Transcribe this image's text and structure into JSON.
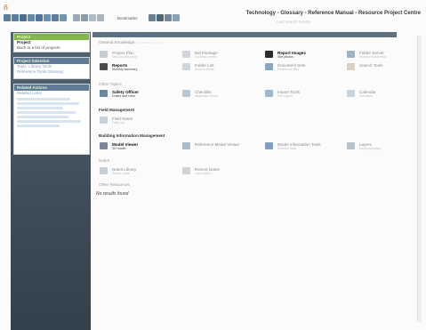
{
  "colors": {
    "accent_green": "#82b84a",
    "sidebar_bg": "#465764",
    "tab_bar": "#5d7282"
  },
  "app": {
    "logo_glyph": "ñ",
    "window_title": "Technology - Glossary - Reference Manual - Resource Project Centre",
    "subtitle": "Last search results",
    "toolbar_label": "Bookmarks",
    "toolbar_icons": [
      "back-arrow-icon",
      "forward-arrow-icon",
      "books-icon",
      "book-icon",
      "library-icon",
      "refresh-icon",
      "home-icon",
      "panel-icon",
      "bookmark-icon",
      "print-icon",
      "search-icon",
      "notes-icon",
      "tools-icon",
      "settings-icon",
      "help-icon",
      "info-icon"
    ]
  },
  "sidebar": {
    "panel1": {
      "header": "Project",
      "title": "Project",
      "line": "Back to a list of projects"
    },
    "panel2": {
      "header": "Project Selection",
      "lines": [
        "Topic: Library Tools",
        "Reference Tools Glossary"
      ]
    },
    "panel3": {
      "header": "Related Actions",
      "line": "Related Links"
    }
  },
  "main": {
    "tab_strip": "Related Topics   Articles   Bookmarks   Glossary",
    "cat_general": "General Knowledge",
    "cat_other": "Other Topics",
    "cat_field": "Field Management",
    "cat_building": "Building Information Management",
    "cat_notes": "Notes",
    "cat_footer": "Other Resources",
    "no_results": "No results found",
    "items": [
      {
        "id": "a1",
        "title": "Project Plan",
        "sub": "Step-by-step plan",
        "icon": "plan-icon",
        "strong": false
      },
      {
        "id": "a2",
        "title": "Bid Package",
        "sub": "Contract review",
        "icon": "package-icon",
        "strong": false
      },
      {
        "id": "a3",
        "title": "Report Images",
        "sub": "Site photos",
        "icon": "camera-icon",
        "strong": true
      },
      {
        "id": "a4",
        "title": "Folder Server",
        "sub": "Shared documents",
        "icon": "server-icon",
        "strong": false
      },
      {
        "id": "b1",
        "title": "Reports",
        "sub": "Monthly summary",
        "icon": "report-icon",
        "strong": true
      },
      {
        "id": "b2",
        "title": "Folder List",
        "sub": "Archive items",
        "icon": "folder-icon",
        "strong": false
      },
      {
        "id": "b3",
        "title": "Document Sets",
        "sub": "Reference files",
        "icon": "documents-icon",
        "strong": false
      },
      {
        "id": "b4",
        "title": "Search Tools",
        "sub": "",
        "icon": "search-tool-icon",
        "strong": false
      },
      {
        "id": "c1",
        "title": "Safety Officer",
        "sub": "Duties and roles",
        "icon": "safety-icon",
        "strong": true
      },
      {
        "id": "c2",
        "title": "Checklist",
        "sub": "Inspection items",
        "icon": "checklist-icon",
        "strong": false
      },
      {
        "id": "c3",
        "title": "Import Tools",
        "sub": "File import",
        "icon": "import-icon",
        "strong": false
      },
      {
        "id": "c4",
        "title": "Calendar",
        "sub": "Schedule",
        "icon": "calendar-icon",
        "strong": false
      },
      {
        "id": "d1",
        "title": "Field Notes",
        "sub": "Daily log",
        "icon": "notes-icon",
        "strong": false
      },
      {
        "id": "e1",
        "title": "Model Viewer",
        "sub": "3D model",
        "icon": "model-icon",
        "strong": true
      },
      {
        "id": "e2",
        "title": "Reference Model Viewer",
        "sub": "",
        "icon": "viewer-icon",
        "strong": false
      },
      {
        "id": "e3",
        "title": "Model Information Tools",
        "sub": "Element data",
        "icon": "info-model-icon",
        "strong": false
      },
      {
        "id": "e4",
        "title": "Layers",
        "sub": "Layer manager",
        "icon": "layers-icon",
        "strong": false
      },
      {
        "id": "f1",
        "title": "Notes Library",
        "sub": "Saved notes",
        "icon": "library-icon",
        "strong": false
      },
      {
        "id": "f2",
        "title": "Recent Notes",
        "sub": "Last edited",
        "icon": "recent-icon",
        "strong": false
      }
    ]
  }
}
